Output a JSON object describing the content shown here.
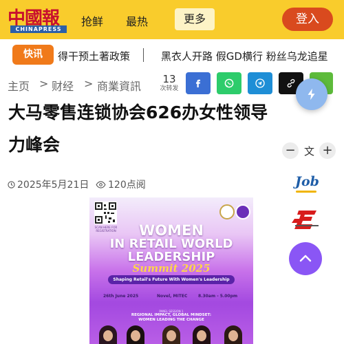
{
  "header": {
    "logo_cn": "中國報",
    "logo_en": "CHINAPRESS",
    "nav": [
      "抢鲜",
      "最热",
      "更多"
    ],
    "login_label": "登入"
  },
  "ticker": {
    "badge": "快讯",
    "items": [
      "得干预土著政策",
      "黑衣人开路 假GD横行 粉丝乌龙追星"
    ]
  },
  "breadcrumb": [
    "主页",
    "财经",
    "商業資訊"
  ],
  "share": {
    "count": "13",
    "count_label": "次转发"
  },
  "article": {
    "title": "大马零售连锁协会626办女性领导力峰会",
    "date": "2025年5月21日",
    "views": "120点阅"
  },
  "font_controls": {
    "minus": "−",
    "label": "文",
    "plus": "+"
  },
  "side_ads": {
    "job_logo": "Job"
  },
  "poster": {
    "qr_caption": "SCAN HERE FOR REGISTRATION",
    "lines": [
      "WOMEN",
      "IN RETAIL WORLD",
      "LEADERSHIP"
    ],
    "summit": "Summit 2025",
    "banner": "Shaping Retail's Future With Women's Leadership",
    "date": "26th June 2025",
    "venue": "Novel, MITEC",
    "time": "8.30am - 5.00pm",
    "panel_head": "PANEL SESSION 1",
    "panel_lines": [
      "REGIONAL IMPACT, GLOBAL MINDSET:",
      "WOMEN LEADING THE CHANGE"
    ]
  },
  "colors": {
    "header_bg": "#f9cc2c",
    "login_bg": "#d94a1e",
    "ticker_badge": "#f07a1a",
    "facebook": "#3b6fd4",
    "whatsapp": "#2dcc6b",
    "telegram": "#1e8ed6",
    "link": "#111111",
    "green_share": "#5dbb3b",
    "scroll_top": "#8a56f5"
  }
}
